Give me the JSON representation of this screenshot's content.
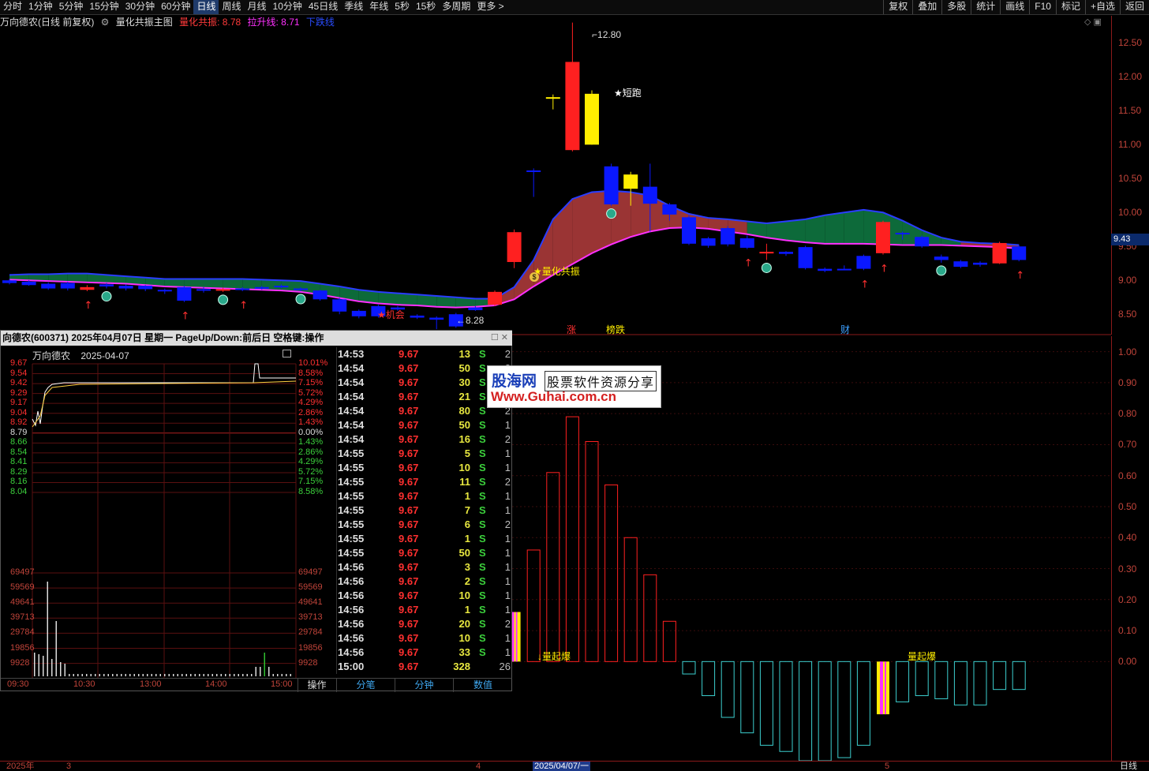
{
  "toolbar": {
    "tabs": [
      "分时",
      "1分钟",
      "5分钟",
      "15分钟",
      "30分钟",
      "60分钟",
      "日线",
      "周线",
      "月线",
      "10分钟",
      "45日线",
      "季线",
      "年线",
      "5秒",
      "15秒",
      "多周期",
      "更多 >"
    ],
    "active_tab": "日线",
    "right_tools": [
      "复权",
      "叠加",
      "多股",
      "统计",
      "画线",
      "F10",
      "标记",
      "+自选",
      "返回"
    ]
  },
  "info": {
    "stock": "万向德农(日线 前复权)",
    "indicator": "量化共振主图",
    "line1": "量化共振: 8.78",
    "line2": "拉升线: 8.71",
    "line3": "下跌线"
  },
  "main_axis": [
    "12.50",
    "12.00",
    "11.50",
    "11.00",
    "10.50",
    "10.00",
    "9.50",
    "9.00",
    "8.50"
  ],
  "last_price": "9.43",
  "indicator_axis": [
    "1.00",
    "0.90",
    "0.80",
    "0.70",
    "0.60",
    "0.50",
    "0.40",
    "0.30",
    "0.20",
    "0.10",
    "0.00"
  ],
  "annotations": {
    "high": "12.80",
    "low": "8.28",
    "short_run": "短跑",
    "resonance": "量化共振",
    "opportunity": "机会",
    "zhang": "涨",
    "bangdie": "榜跌",
    "cai": "财",
    "burst1": "量起爆",
    "burst2": "量起爆",
    "dollar": "$"
  },
  "popup": {
    "title": "向德农(600371) 2025年04月07日 星期一 PageUp/Down:前后日 空格键:操作",
    "mini_name": "万向德农",
    "mini_date": "2025-04-07",
    "prices_left": [
      "9.67",
      "9.54",
      "9.42",
      "9.29",
      "9.17",
      "9.04",
      "8.92",
      "8.79",
      "8.66",
      "8.54",
      "8.41",
      "8.29",
      "8.16",
      "8.04"
    ],
    "pct_right": [
      "10.01%",
      "8.58%",
      "7.15%",
      "5.72%",
      "4.29%",
      "2.86%",
      "1.43%",
      "0.00%",
      "1.43%",
      "2.86%",
      "4.29%",
      "5.72%",
      "7.15%",
      "8.58%"
    ],
    "vol_labels": [
      "69497",
      "59569",
      "49641",
      "39713",
      "29784",
      "19856",
      "9928"
    ],
    "time_labels": [
      "09:30",
      "10:30",
      "13:00",
      "14:00",
      "15:00"
    ],
    "trades": [
      {
        "t": "14:53",
        "p": "9.67",
        "v": "13",
        "s": "S",
        "n": "2"
      },
      {
        "t": "14:54",
        "p": "9.67",
        "v": "50",
        "s": "S",
        "n": "2"
      },
      {
        "t": "14:54",
        "p": "9.67",
        "v": "30",
        "s": "S",
        "n": "2"
      },
      {
        "t": "14:54",
        "p": "9.67",
        "v": "21",
        "s": "S",
        "n": "2"
      },
      {
        "t": "14:54",
        "p": "9.67",
        "v": "80",
        "s": "S",
        "n": "2"
      },
      {
        "t": "14:54",
        "p": "9.67",
        "v": "50",
        "s": "S",
        "n": "1"
      },
      {
        "t": "14:54",
        "p": "9.67",
        "v": "16",
        "s": "S",
        "n": "2"
      },
      {
        "t": "14:55",
        "p": "9.67",
        "v": "5",
        "s": "S",
        "n": "1"
      },
      {
        "t": "14:55",
        "p": "9.67",
        "v": "10",
        "s": "S",
        "n": "1"
      },
      {
        "t": "14:55",
        "p": "9.67",
        "v": "11",
        "s": "S",
        "n": "2"
      },
      {
        "t": "14:55",
        "p": "9.67",
        "v": "1",
        "s": "S",
        "n": "1"
      },
      {
        "t": "14:55",
        "p": "9.67",
        "v": "7",
        "s": "S",
        "n": "1"
      },
      {
        "t": "14:55",
        "p": "9.67",
        "v": "6",
        "s": "S",
        "n": "2"
      },
      {
        "t": "14:55",
        "p": "9.67",
        "v": "1",
        "s": "S",
        "n": "1"
      },
      {
        "t": "14:55",
        "p": "9.67",
        "v": "50",
        "s": "S",
        "n": "1"
      },
      {
        "t": "14:56",
        "p": "9.67",
        "v": "3",
        "s": "S",
        "n": "1"
      },
      {
        "t": "14:56",
        "p": "9.67",
        "v": "2",
        "s": "S",
        "n": "1"
      },
      {
        "t": "14:56",
        "p": "9.67",
        "v": "10",
        "s": "S",
        "n": "1"
      },
      {
        "t": "14:56",
        "p": "9.67",
        "v": "1",
        "s": "S",
        "n": "1"
      },
      {
        "t": "14:56",
        "p": "9.67",
        "v": "20",
        "s": "S",
        "n": "2"
      },
      {
        "t": "14:56",
        "p": "9.67",
        "v": "10",
        "s": "S",
        "n": "1"
      },
      {
        "t": "14:56",
        "p": "9.67",
        "v": "33",
        "s": "S",
        "n": "1"
      },
      {
        "t": "15:00",
        "p": "9.67",
        "v": "328",
        "s": "",
        "n": "26"
      }
    ],
    "footer": {
      "op": "操作",
      "tab1": "分笔",
      "tab2": "分钟",
      "tab3": "数值"
    }
  },
  "watermark": {
    "brand": "股海网",
    "slogan": "股票软件资源分享",
    "url": "Www.Guhai.com.cn"
  },
  "bottom": {
    "year": "2025年",
    "m3": "3",
    "m4": "4",
    "sel": "2025/04/07/一",
    "m5": "5",
    "period": "日线"
  },
  "colors": {
    "up": "#ff2020",
    "down": "#0a18ff",
    "yellow": "#ffee00",
    "cloud_red": "#9a3434",
    "cloud_green": "#0d6a3a",
    "axis": "#c0443a",
    "pink": "#ff30ff",
    "cyan": "#3ccfcf"
  },
  "chart_data": [
    {
      "type": "candlestick",
      "title": "",
      "ylim": [
        8.2,
        12.9
      ],
      "candles": [
        [
          9.0,
          8.96,
          9.02,
          8.94
        ],
        [
          8.98,
          8.93,
          9.0,
          8.92
        ],
        [
          8.95,
          8.88,
          8.97,
          8.86
        ],
        [
          8.96,
          8.88,
          8.98,
          8.85
        ],
        [
          8.86,
          8.9,
          8.93,
          8.84
        ],
        [
          8.94,
          8.91,
          8.96,
          8.88
        ],
        [
          8.92,
          8.88,
          8.94,
          8.85
        ],
        [
          8.92,
          8.87,
          8.93,
          8.84
        ],
        [
          8.86,
          8.84,
          8.88,
          8.8
        ],
        [
          8.9,
          8.7,
          8.92,
          8.68
        ],
        [
          8.87,
          8.85,
          8.9,
          8.82
        ],
        [
          8.85,
          8.87,
          8.89,
          8.83
        ],
        [
          8.88,
          8.86,
          8.9,
          8.84
        ],
        [
          8.9,
          8.88,
          8.92,
          8.86
        ],
        [
          8.92,
          8.9,
          8.94,
          8.88
        ],
        [
          8.88,
          8.86,
          8.9,
          8.84
        ],
        [
          8.85,
          8.72,
          8.86,
          8.7
        ],
        [
          8.72,
          8.54,
          8.74,
          8.5
        ],
        [
          8.55,
          8.47,
          8.57,
          8.44
        ],
        [
          8.62,
          8.47,
          8.64,
          8.45
        ],
        [
          8.6,
          8.57,
          8.62,
          8.55
        ],
        [
          8.48,
          8.45,
          8.5,
          8.43
        ],
        [
          8.45,
          8.42,
          8.47,
          8.28
        ],
        [
          8.5,
          8.32,
          8.52,
          8.3
        ],
        [
          8.6,
          8.56,
          8.62,
          8.55
        ],
        [
          8.64,
          8.83,
          8.85,
          8.62
        ],
        [
          9.27,
          9.71,
          9.75,
          9.18
        ],
        [
          10.62,
          10.61,
          10.65,
          10.23
        ],
        [
          11.69,
          11.7,
          11.74,
          11.52
        ],
        [
          10.92,
          12.22,
          12.8,
          10.9
        ],
        [
          11.75,
          11.0,
          11.8,
          11.0
        ],
        [
          10.68,
          10.12,
          10.72,
          10.1
        ],
        [
          10.56,
          10.35,
          10.6,
          10.1
        ],
        [
          10.38,
          10.13,
          10.72,
          9.72
        ],
        [
          10.12,
          9.97,
          10.14,
          9.88
        ],
        [
          9.93,
          9.54,
          9.96,
          9.52
        ],
        [
          9.62,
          9.51,
          9.64,
          9.48
        ],
        [
          9.77,
          9.53,
          9.8,
          9.5
        ],
        [
          9.62,
          9.48,
          9.66,
          9.46
        ],
        [
          9.42,
          9.42,
          9.54,
          9.3
        ],
        [
          9.42,
          9.39,
          9.43,
          9.36
        ],
        [
          9.49,
          9.18,
          9.51,
          9.16
        ],
        [
          9.17,
          9.14,
          9.19,
          9.12
        ],
        [
          9.17,
          9.16,
          9.22,
          9.16
        ],
        [
          9.36,
          9.17,
          9.38,
          9.15
        ],
        [
          9.4,
          9.86,
          9.88,
          9.38
        ],
        [
          9.7,
          9.68,
          9.72,
          9.6
        ],
        [
          9.64,
          9.5,
          9.66,
          9.48
        ],
        [
          9.35,
          9.3,
          9.38,
          9.26
        ],
        [
          9.28,
          9.2,
          9.3,
          9.18
        ],
        [
          9.26,
          9.23,
          9.28,
          9.2
        ],
        [
          9.25,
          9.55,
          9.57,
          9.24
        ],
        [
          9.5,
          9.3,
          9.52,
          9.28
        ]
      ],
      "series": [
        {
          "name": "量化共振",
          "values": [
            9.08,
            9.09,
            9.09,
            9.1,
            9.1,
            9.08,
            9.06,
            9.04,
            9.02,
            9.02,
            9.02,
            9.02,
            9.02,
            9.01,
            9.0,
            8.99,
            8.95,
            8.91,
            8.86,
            8.83,
            8.81,
            8.79,
            8.77,
            8.75,
            8.73,
            8.73,
            8.9,
            9.3,
            9.9,
            10.2,
            10.3,
            10.32,
            10.3,
            10.25,
            10.1,
            9.98,
            9.92,
            9.9,
            9.87,
            9.84,
            9.87,
            9.9,
            9.96,
            10.0,
            10.04,
            10.0,
            9.88,
            9.74,
            9.63,
            9.57,
            9.55,
            9.54,
            9.52
          ]
        },
        {
          "name": "拉升线",
          "values": [
            9.01,
            9.0,
            8.99,
            8.98,
            8.97,
            8.96,
            8.95,
            8.93,
            8.91,
            8.9,
            8.89,
            8.88,
            8.87,
            8.86,
            8.85,
            8.83,
            8.79,
            8.74,
            8.69,
            8.66,
            8.64,
            8.63,
            8.61,
            8.6,
            8.61,
            8.63,
            8.72,
            8.91,
            9.08,
            9.24,
            9.4,
            9.53,
            9.64,
            9.72,
            9.77,
            9.78,
            9.76,
            9.72,
            9.68,
            9.63,
            9.59,
            9.56,
            9.54,
            9.54,
            9.54,
            9.53,
            9.52,
            9.52,
            9.52,
            9.51,
            9.5,
            9.49,
            9.47
          ]
        }
      ]
    },
    {
      "type": "bar",
      "title": "",
      "ylim": [
        -0.32,
        1.05
      ],
      "values": [
        0.0,
        0.0,
        0.0,
        0.0,
        0.0,
        0.0,
        0.0,
        0.0,
        0.0,
        0.0,
        0.0,
        0.0,
        0.0,
        0.0,
        0.0,
        0.0,
        0.0,
        0.0,
        0.0,
        0.0,
        0.0,
        0.0,
        0.0,
        0.0,
        0.0,
        0.02,
        0.16,
        0.36,
        0.61,
        0.79,
        0.71,
        0.57,
        0.4,
        0.28,
        0.13,
        -0.04,
        -0.11,
        -0.18,
        -0.23,
        -0.27,
        -0.29,
        -0.32,
        -0.32,
        -0.31,
        -0.27,
        -0.17,
        -0.13,
        -0.11,
        -0.12,
        -0.14,
        -0.14,
        -0.09,
        -0.09
      ],
      "highlight": [
        26,
        45
      ]
    }
  ]
}
